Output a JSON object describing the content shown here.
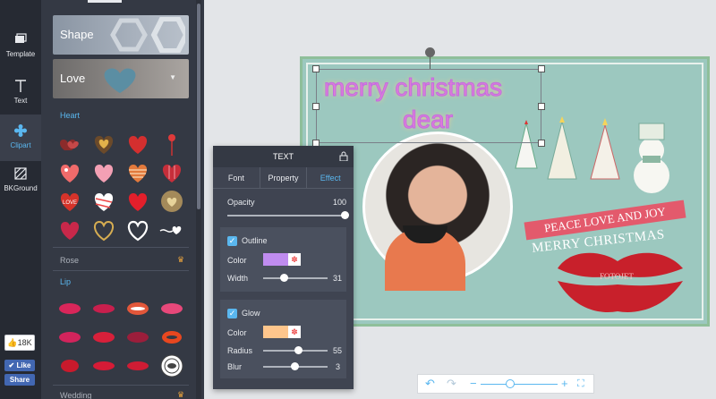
{
  "rail": {
    "items": [
      {
        "label": "Template",
        "icon": "template-icon"
      },
      {
        "label": "Text",
        "icon": "text-icon"
      },
      {
        "label": "Clipart",
        "icon": "clipart-icon"
      },
      {
        "label": "BKGround",
        "icon": "background-icon"
      }
    ],
    "active": "Clipart"
  },
  "social": {
    "like_count": "18K",
    "like_label": "Like",
    "share_label": "Share"
  },
  "clipart_panel": {
    "categories": [
      {
        "label": "Shape"
      },
      {
        "label": "Love"
      }
    ],
    "sections": {
      "heart": "Heart",
      "rose": "Rose",
      "lip": "Lip",
      "wedding": "Wedding"
    }
  },
  "design": {
    "headline_line1": "merry christmas",
    "headline_line2": "dear",
    "banner_text": "PEACE LOVE AND JOY",
    "banner_text2": "MERRY CHRISTMAS",
    "lips_caption": "FOTOJET"
  },
  "text_panel": {
    "title": "TEXT",
    "tabs": [
      "Font",
      "Property",
      "Effect"
    ],
    "active_tab": "Effect",
    "opacity_label": "Opacity",
    "opacity_value": "100",
    "outline": {
      "label": "Outline",
      "enabled": true,
      "color_label": "Color",
      "color": "#c08cf0",
      "width_label": "Width",
      "width_value": "31"
    },
    "glow": {
      "label": "Glow",
      "enabled": true,
      "color_label": "Color",
      "color": "#ffc68c",
      "radius_label": "Radius",
      "radius_value": "55",
      "blur_label": "Blur",
      "blur_value": "3"
    }
  },
  "zoom_bar": {
    "undo_icon": "undo-icon",
    "redo_icon": "redo-icon",
    "zoom_out": "−",
    "zoom_in": "+",
    "fullscreen_icon": "fullscreen-icon"
  },
  "colors": {
    "accent": "#5ab7ef",
    "panel_dark": "#343944",
    "rail": "#262a33"
  }
}
